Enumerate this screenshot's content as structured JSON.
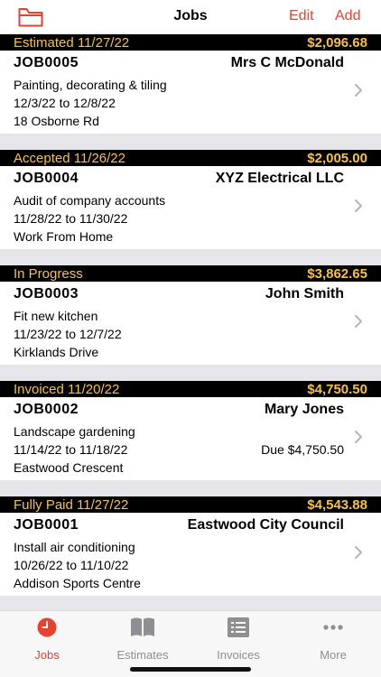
{
  "nav": {
    "title": "Jobs",
    "edit_label": "Edit",
    "add_label": "Add"
  },
  "jobs": [
    {
      "status": "Estimated 11/27/22",
      "amount": "$2,096.68",
      "code": "JOB0005",
      "client": "Mrs C McDonald",
      "description": "Painting, decorating & tiling",
      "dates": "12/3/22 to 12/8/22",
      "address": "18 Osborne Rd",
      "due": ""
    },
    {
      "status": "Accepted 11/26/22",
      "amount": "$2,005.00",
      "code": "JOB0004",
      "client": "XYZ Electrical LLC",
      "description": "Audit of company accounts",
      "dates": "11/28/22 to 11/30/22",
      "address": "Work From Home",
      "due": ""
    },
    {
      "status": "In Progress",
      "amount": "$3,862.65",
      "code": "JOB0003",
      "client": "John Smith",
      "description": "Fit new kitchen",
      "dates": "11/23/22 to 12/7/22",
      "address": "Kirklands Drive",
      "due": ""
    },
    {
      "status": "Invoiced 11/20/22",
      "amount": "$4,750.50",
      "code": "JOB0002",
      "client": "Mary Jones",
      "description": "Landscape gardening",
      "dates": "11/14/22 to 11/18/22",
      "address": "Eastwood Crescent",
      "due": "Due $4,750.50"
    },
    {
      "status": "Fully Paid 11/27/22",
      "amount": "$4,543.88",
      "code": "JOB0001",
      "client": "Eastwood City Council",
      "description": "Install air conditioning",
      "dates": "10/26/22 to 11/10/22",
      "address": "Addison Sports Centre",
      "due": ""
    }
  ],
  "tabs": [
    {
      "label": "Jobs",
      "icon": "clock-icon",
      "active": true
    },
    {
      "label": "Estimates",
      "icon": "book-icon",
      "active": false
    },
    {
      "label": "Invoices",
      "icon": "list-icon",
      "active": false
    },
    {
      "label": "More",
      "icon": "more-icon",
      "active": false
    }
  ],
  "colors": {
    "accent": "#e9412e",
    "header_bg": "#000000",
    "header_text": "#f5c243",
    "separator": "#e6e6ea",
    "tab_inactive": "#8e8e93"
  }
}
